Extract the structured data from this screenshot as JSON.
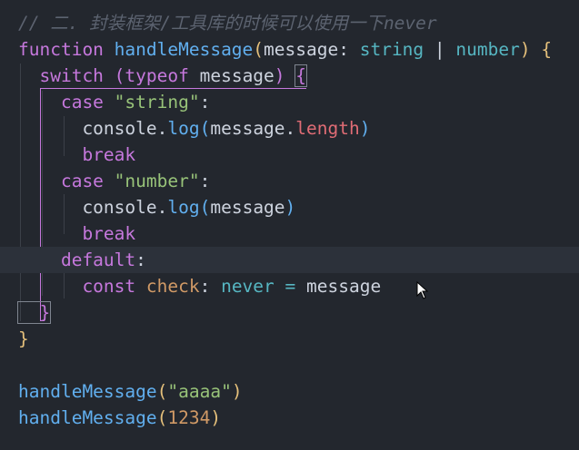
{
  "editor": {
    "lines": [
      {
        "tokens": [
          {
            "t": "// 二. 封装框架/工具库的时候可以使用一下never",
            "c": "comment"
          }
        ]
      },
      {
        "tokens": [
          {
            "t": "function ",
            "c": "kw"
          },
          {
            "t": "handleMessage",
            "c": "fn"
          },
          {
            "t": "(",
            "c": "brace-y"
          },
          {
            "t": "message",
            "c": "plain"
          },
          {
            "t": ": ",
            "c": "plain"
          },
          {
            "t": "string",
            "c": "type"
          },
          {
            "t": " | ",
            "c": "plain"
          },
          {
            "t": "number",
            "c": "type"
          },
          {
            "t": ") ",
            "c": "brace-y"
          },
          {
            "t": "{",
            "c": "brace-y"
          }
        ]
      },
      {
        "tokens": [
          {
            "t": "  switch ",
            "c": "kw"
          },
          {
            "t": "(",
            "c": "brace-p"
          },
          {
            "t": "typeof ",
            "c": "kw"
          },
          {
            "t": "message",
            "c": "plain"
          },
          {
            "t": ") ",
            "c": "brace-p"
          },
          {
            "t": "{",
            "c": "brace-p brace-hl"
          }
        ]
      },
      {
        "tokens": [
          {
            "t": "    case ",
            "c": "kw"
          },
          {
            "t": "\"string\"",
            "c": "str"
          },
          {
            "t": ":",
            "c": "plain"
          }
        ]
      },
      {
        "tokens": [
          {
            "t": "      console",
            "c": "plain"
          },
          {
            "t": ".",
            "c": "plain"
          },
          {
            "t": "log",
            "c": "fn"
          },
          {
            "t": "(",
            "c": "brace-b"
          },
          {
            "t": "message",
            "c": "plain"
          },
          {
            "t": ".",
            "c": "plain"
          },
          {
            "t": "length",
            "c": "prop"
          },
          {
            "t": ")",
            "c": "brace-b"
          }
        ]
      },
      {
        "tokens": [
          {
            "t": "      break",
            "c": "kw"
          }
        ]
      },
      {
        "tokens": [
          {
            "t": "    case ",
            "c": "kw"
          },
          {
            "t": "\"number\"",
            "c": "str"
          },
          {
            "t": ":",
            "c": "plain"
          }
        ]
      },
      {
        "tokens": [
          {
            "t": "      console",
            "c": "plain"
          },
          {
            "t": ".",
            "c": "plain"
          },
          {
            "t": "log",
            "c": "fn"
          },
          {
            "t": "(",
            "c": "brace-b"
          },
          {
            "t": "message",
            "c": "plain"
          },
          {
            "t": ")",
            "c": "brace-b"
          }
        ]
      },
      {
        "tokens": [
          {
            "t": "      break",
            "c": "kw"
          }
        ]
      },
      {
        "tokens": [
          {
            "t": "    default",
            "c": "kw"
          },
          {
            "t": ":",
            "c": "plain"
          }
        ]
      },
      {
        "tokens": [
          {
            "t": "      const ",
            "c": "kw"
          },
          {
            "t": "check",
            "c": "param"
          },
          {
            "t": ": ",
            "c": "plain"
          },
          {
            "t": "never",
            "c": "type"
          },
          {
            "t": " = ",
            "c": "type"
          },
          {
            "t": "message",
            "c": "plain"
          }
        ]
      },
      {
        "tokens": [
          {
            "t": "  }",
            "c": "brace-p brace-hl"
          }
        ]
      },
      {
        "tokens": [
          {
            "t": "}",
            "c": "brace-y"
          }
        ]
      },
      {
        "tokens": []
      },
      {
        "tokens": [
          {
            "t": "handleMessage",
            "c": "fn"
          },
          {
            "t": "(",
            "c": "brace-y"
          },
          {
            "t": "\"aaaa\"",
            "c": "str"
          },
          {
            "t": ")",
            "c": "brace-y"
          }
        ]
      },
      {
        "tokens": [
          {
            "t": "handleMessage",
            "c": "fn"
          },
          {
            "t": "(",
            "c": "brace-y"
          },
          {
            "t": "1234",
            "c": "num"
          },
          {
            "t": ")",
            "c": "brace-y"
          }
        ]
      }
    ],
    "current_line": 9,
    "cursor_icon": "mouse-pointer-icon"
  }
}
